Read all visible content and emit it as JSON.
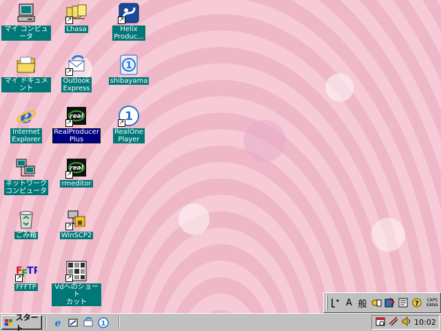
{
  "desktop": {
    "icons": [
      {
        "label": "マイ コンピュータ",
        "icon": "my-computer-icon"
      },
      {
        "label": "Lhasa",
        "icon": "lhasa-icon"
      },
      {
        "label": "Helix\nProduc...",
        "icon": "helix-producer-icon"
      },
      {
        "label": "マイ ドキュメント",
        "icon": "my-documents-icon"
      },
      {
        "label": "Outlook\nExpress",
        "icon": "outlook-express-icon"
      },
      {
        "label": "shibayama",
        "icon": "shibayama-icon"
      },
      {
        "label": "Internet\nExplorer",
        "icon": "internet-explorer-icon"
      },
      {
        "label": "RealProducer\nPlus",
        "icon": "realproducer-icon"
      },
      {
        "label": "RealOne\nPlayer",
        "icon": "realone-player-icon"
      },
      {
        "label": "ネットワーク\nコンピュータ",
        "icon": "network-computer-icon"
      },
      {
        "label": "rmeditor",
        "icon": "rmeditor-icon"
      },
      {
        "label": "ごみ箱",
        "icon": "recycle-bin-icon"
      },
      {
        "label": "WinSCP2",
        "icon": "winscp-icon"
      },
      {
        "label": "FFFTP",
        "icon": "ffftp-icon"
      },
      {
        "label": "Vdへのショート\nカット",
        "icon": "vd-shortcut-icon"
      }
    ]
  },
  "langbar": {
    "mode_label": "A",
    "kanji_label": "般",
    "caps_label": "CAPS",
    "kana_label": "KANA"
  },
  "taskbar": {
    "start_label": "スタート",
    "clock": "10:02"
  },
  "colors": {
    "label_bg": "#007878",
    "selected_bg": "#000080",
    "taskbar": "#c0c0c0"
  }
}
